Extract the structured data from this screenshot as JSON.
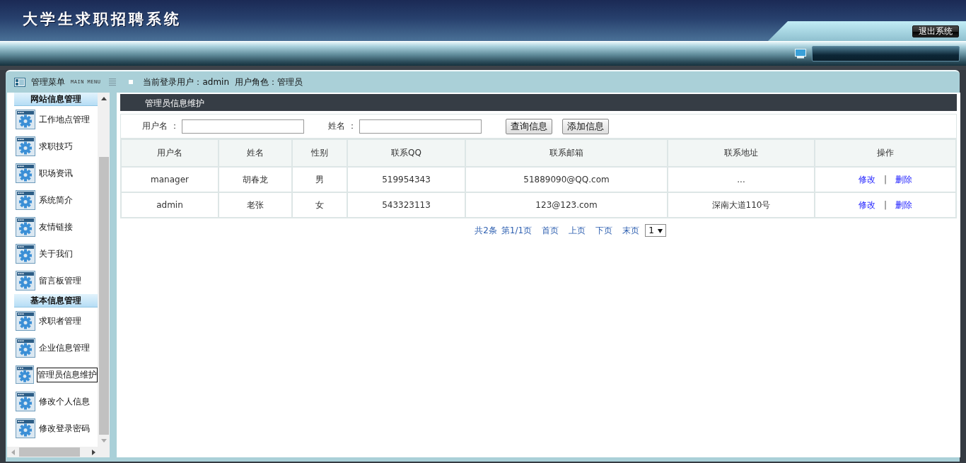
{
  "header": {
    "title": "大学生求职招聘系统",
    "logout_button": "退出系统"
  },
  "menu_header": {
    "title": "管理菜单",
    "subtitle": "MAIN MENU"
  },
  "user_info": "当前登录用户：admin  用户角色：管理员",
  "sidebar": {
    "groups": [
      {
        "title": "网站信息管理",
        "items": [
          {
            "label": "工作地点管理",
            "selected": false
          },
          {
            "label": "求职技巧",
            "selected": false
          },
          {
            "label": "职场资讯",
            "selected": false
          },
          {
            "label": "系统简介",
            "selected": false
          },
          {
            "label": "友情链接",
            "selected": false
          },
          {
            "label": "关于我们",
            "selected": false
          },
          {
            "label": "留言板管理",
            "selected": false
          }
        ]
      },
      {
        "title": "基本信息管理",
        "items": [
          {
            "label": "求职者管理",
            "selected": false
          },
          {
            "label": "企业信息管理",
            "selected": false
          },
          {
            "label": "管理员信息维护",
            "selected": true
          },
          {
            "label": "修改个人信息",
            "selected": false
          },
          {
            "label": "修改登录密码",
            "selected": false
          }
        ]
      }
    ]
  },
  "content": {
    "title": "管理员信息维护",
    "search": {
      "fields": [
        {
          "label": "用户名 ："
        },
        {
          "label": "姓名 ："
        }
      ],
      "buttons": [
        "查询信息",
        "添加信息"
      ]
    },
    "table": {
      "columns": [
        "用户名",
        "姓名",
        "性别",
        "联系QQ",
        "联系邮箱",
        "联系地址",
        "操作"
      ],
      "rows": [
        {
          "cells": [
            "manager",
            "胡春龙",
            "男",
            "519954343",
            "51889090@QQ.com",
            "..."
          ],
          "actions": {
            "edit": "修改",
            "separator": "|",
            "delete": "删除"
          }
        },
        {
          "cells": [
            "admin",
            "老张",
            "女",
            "543323113",
            "123@123.com",
            "深南大道110号"
          ],
          "actions": {
            "edit": "修改",
            "separator": "|",
            "delete": "删除"
          }
        }
      ]
    },
    "pagination": {
      "total": "共2条",
      "page": "第1/1页",
      "links": [
        "首页",
        "上页",
        "下页",
        "末页"
      ],
      "page_select": "1"
    }
  }
}
